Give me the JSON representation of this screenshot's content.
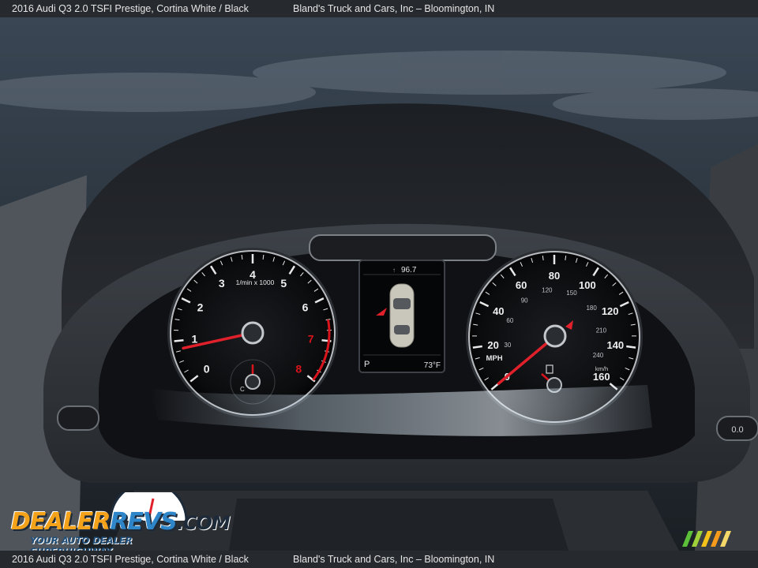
{
  "caption": {
    "listing": "2016 Audi Q3 2.0 TSFI Prestige,  Cortina White / Black",
    "dealer": "Bland's Truck and Cars, Inc – Bloomington, IN"
  },
  "tachometer": {
    "ticks": [
      "0",
      "1",
      "2",
      "3",
      "4",
      "5",
      "6",
      "7",
      "8"
    ],
    "unit": "1/min x 1000",
    "needle_rpm_x1000": 0.8,
    "coolant_label": "C"
  },
  "speedometer": {
    "mph_ticks": [
      "0",
      "20",
      "40",
      "60",
      "80",
      "100",
      "120",
      "140",
      "160"
    ],
    "kmh_ticks": [
      "30",
      "60",
      "90",
      "120",
      "150",
      "180",
      "210",
      "240"
    ],
    "mph_label": "MPH",
    "kmh_label": "km/h",
    "needle_mph": 0
  },
  "display": {
    "odometer": "96.7",
    "gear": "P",
    "temperature": "73°F"
  },
  "buttons": {
    "right_reset": "0.0"
  },
  "watermark": {
    "brand_part1": "DEALER",
    "brand_part2": "REVS",
    "brand_part3": ".COM",
    "tagline": "YOUR AUTO DEALER SUPERHIGHWAY"
  },
  "colors": {
    "needle": "#e0202a",
    "redline": "#d8141c",
    "brand_orange": "#f5a21b",
    "brand_blue": "#2e86c8"
  }
}
